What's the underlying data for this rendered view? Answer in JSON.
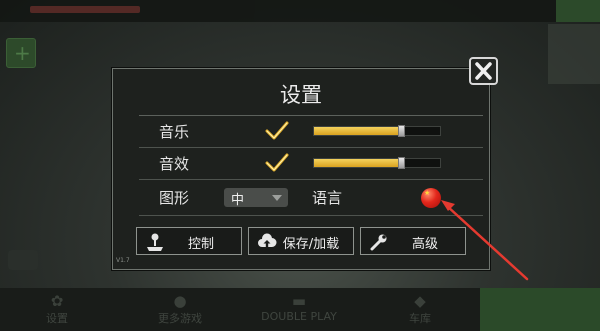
{
  "dialog": {
    "title": "设置",
    "close_icon": "close-x-icon",
    "music": {
      "label": "音乐",
      "enabled": true,
      "volume": 0.7
    },
    "sfx": {
      "label": "音效",
      "enabled": true,
      "volume": 0.7
    },
    "graphics": {
      "label": "图形",
      "value": "中"
    },
    "language": {
      "label": "语言",
      "flag_icon": "china-flag-icon"
    },
    "buttons": [
      {
        "label": "控制",
        "icon": "joystick-icon"
      },
      {
        "label": "保存/加载",
        "icon": "cloud-upload-icon"
      },
      {
        "label": "高级",
        "icon": "wrench-icon"
      }
    ],
    "version": "V1.7"
  },
  "background": {
    "nav_items": [
      "设置",
      "更多游戏",
      "DOUBLE PLAY",
      "车库"
    ]
  },
  "colors": {
    "accent_gold": "#e0ad2a",
    "annotation_red": "#e53a30",
    "flag_red": "#e3261b"
  }
}
